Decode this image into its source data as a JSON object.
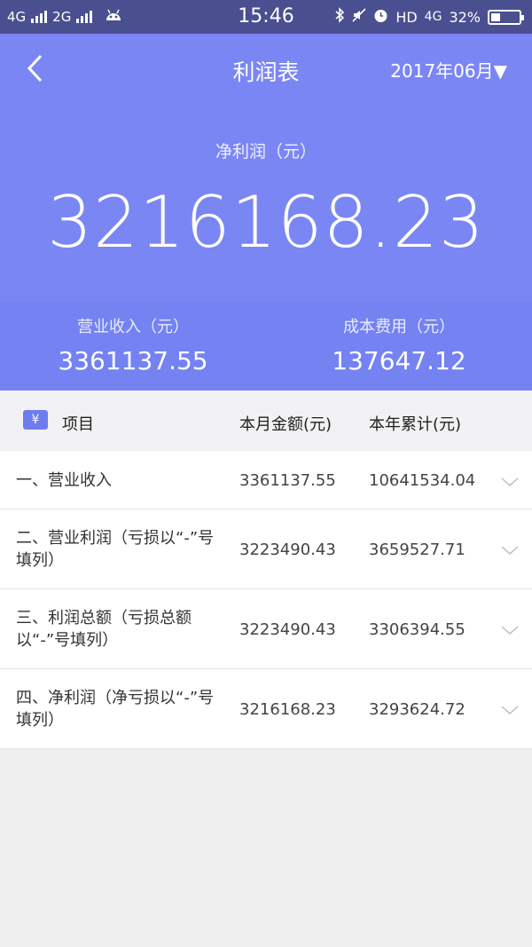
{
  "status": {
    "net1": "4G",
    "net2": "2G",
    "time": "15:46",
    "hd": "HD",
    "net3": "4G",
    "battery_text": "32%",
    "battery_level": 0.32
  },
  "header": {
    "title": "利润表",
    "date": "2017年06月▼"
  },
  "hero": {
    "label": "净利润（元）",
    "value": "3216168.23"
  },
  "summary": {
    "revenue_label": "营业收入（元）",
    "revenue_value": "3361137.55",
    "cost_label": "成本费用（元）",
    "cost_value": "137647.12"
  },
  "table": {
    "badge": "¥",
    "headers": [
      "项目",
      "本月金额(元)",
      "本年累计(元)"
    ],
    "rows": [
      {
        "name": "一、营业收入",
        "month": "3361137.55",
        "year": "10641534.04"
      },
      {
        "name": "二、营业利润（亏损以“-”号填列）",
        "month": "3223490.43",
        "year": "3659527.71"
      },
      {
        "name": "三、利润总额（亏损总额以“-”号填列）",
        "month": "3223490.43",
        "year": "3306394.55"
      },
      {
        "name": "四、净利润（净亏损以“-”号填列）",
        "month": "3216168.23",
        "year": "3293624.72"
      }
    ]
  },
  "colors": {
    "status_bar": "#4a4f8f",
    "hero": "#7b86f5",
    "summary": "#7482f2"
  }
}
